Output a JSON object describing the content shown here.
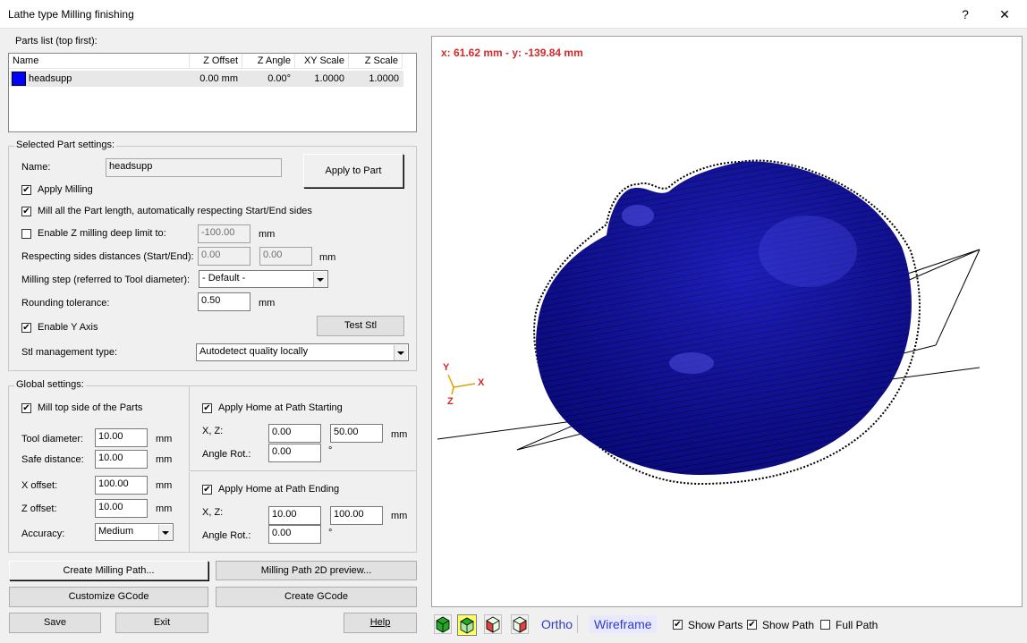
{
  "window": {
    "title": "Lathe type Milling finishing",
    "help_glyph": "?",
    "close_glyph": "✕"
  },
  "parts_list": {
    "label": "Parts list (top first):",
    "columns": [
      "Name",
      "Z Offset",
      "Z Angle",
      "XY Scale",
      "Z Scale"
    ],
    "rows": [
      {
        "color": "#0000ff",
        "name": "headsupp",
        "z_offset": "0.00 mm",
        "z_angle": "0.00°",
        "xy_scale": "1.0000",
        "z_scale": "1.0000"
      }
    ]
  },
  "selected_part": {
    "legend": "Selected Part settings:",
    "name_label": "Name:",
    "name_value": "headsupp",
    "apply_button": "Apply to Part",
    "apply_milling": "Apply Milling",
    "mill_all_length": "Mill all the Part length, automatically respecting Start/End sides",
    "enable_z_limit": "Enable Z milling deep limit to:",
    "z_limit_value": "-100.00",
    "z_limit_unit": "mm",
    "sides_label": "Respecting sides distances (Start/End):",
    "side_start": "0.00",
    "side_end": "0.00",
    "sides_unit": "mm",
    "milling_step_label": "Milling step (referred to Tool diameter):",
    "milling_step_value": "- Default -",
    "rounding_label": "Rounding tolerance:",
    "rounding_value": "0.50",
    "rounding_unit": "mm",
    "enable_y_axis": "Enable Y Axis",
    "test_stl_button": "Test Stl",
    "stl_label": "Stl management type:",
    "stl_value": "Autodetect quality locally"
  },
  "global_settings": {
    "legend": "Global settings:",
    "mill_top": "Mill top side of the Parts",
    "tool_diameter_label": "Tool diameter:",
    "tool_diameter_value": "10.00",
    "safe_distance_label": "Safe distance:",
    "safe_distance_value": "10.00",
    "x_offset_label": "X offset:",
    "x_offset_value": "100.00",
    "z_offset_label": "Z offset:",
    "z_offset_value": "10.00",
    "unit": "mm",
    "accuracy_label": "Accuracy:",
    "accuracy_value": "Medium",
    "home_start_label": "Apply Home at Path Starting",
    "home_start_xz_label": "X, Z:",
    "home_start_x": "0.00",
    "home_start_z": "50.00",
    "home_start_angle_label": "Angle Rot.:",
    "home_start_angle": "0.00",
    "home_end_label": "Apply Home at Path Ending",
    "home_end_xz_label": "X, Z:",
    "home_end_x": "10.00",
    "home_end_z": "100.00",
    "home_end_angle_label": "Angle Rot.:",
    "home_end_angle": "0.00",
    "degree_glyph": "°"
  },
  "buttons": {
    "create_path": "Create Milling Path...",
    "preview_2d": "Milling Path 2D preview...",
    "customize_gcode": "Customize GCode",
    "create_gcode": "Create GCode",
    "save": "Save",
    "exit": "Exit",
    "help": "Help"
  },
  "viewport": {
    "coords": "x: 61.62 mm - y: -139.84 mm",
    "axis_y": "Y",
    "axis_x": "X",
    "axis_z": "Z",
    "model_color": "#0f0fb4"
  },
  "view_toolbar": {
    "ortho": "Ortho",
    "wireframe": "Wireframe",
    "show_parts": "Show Parts",
    "show_path": "Show Path",
    "full_path": "Full Path",
    "icons": [
      "view-front-icon",
      "view-top-icon",
      "view-side-left-icon",
      "view-side-right-icon"
    ]
  }
}
